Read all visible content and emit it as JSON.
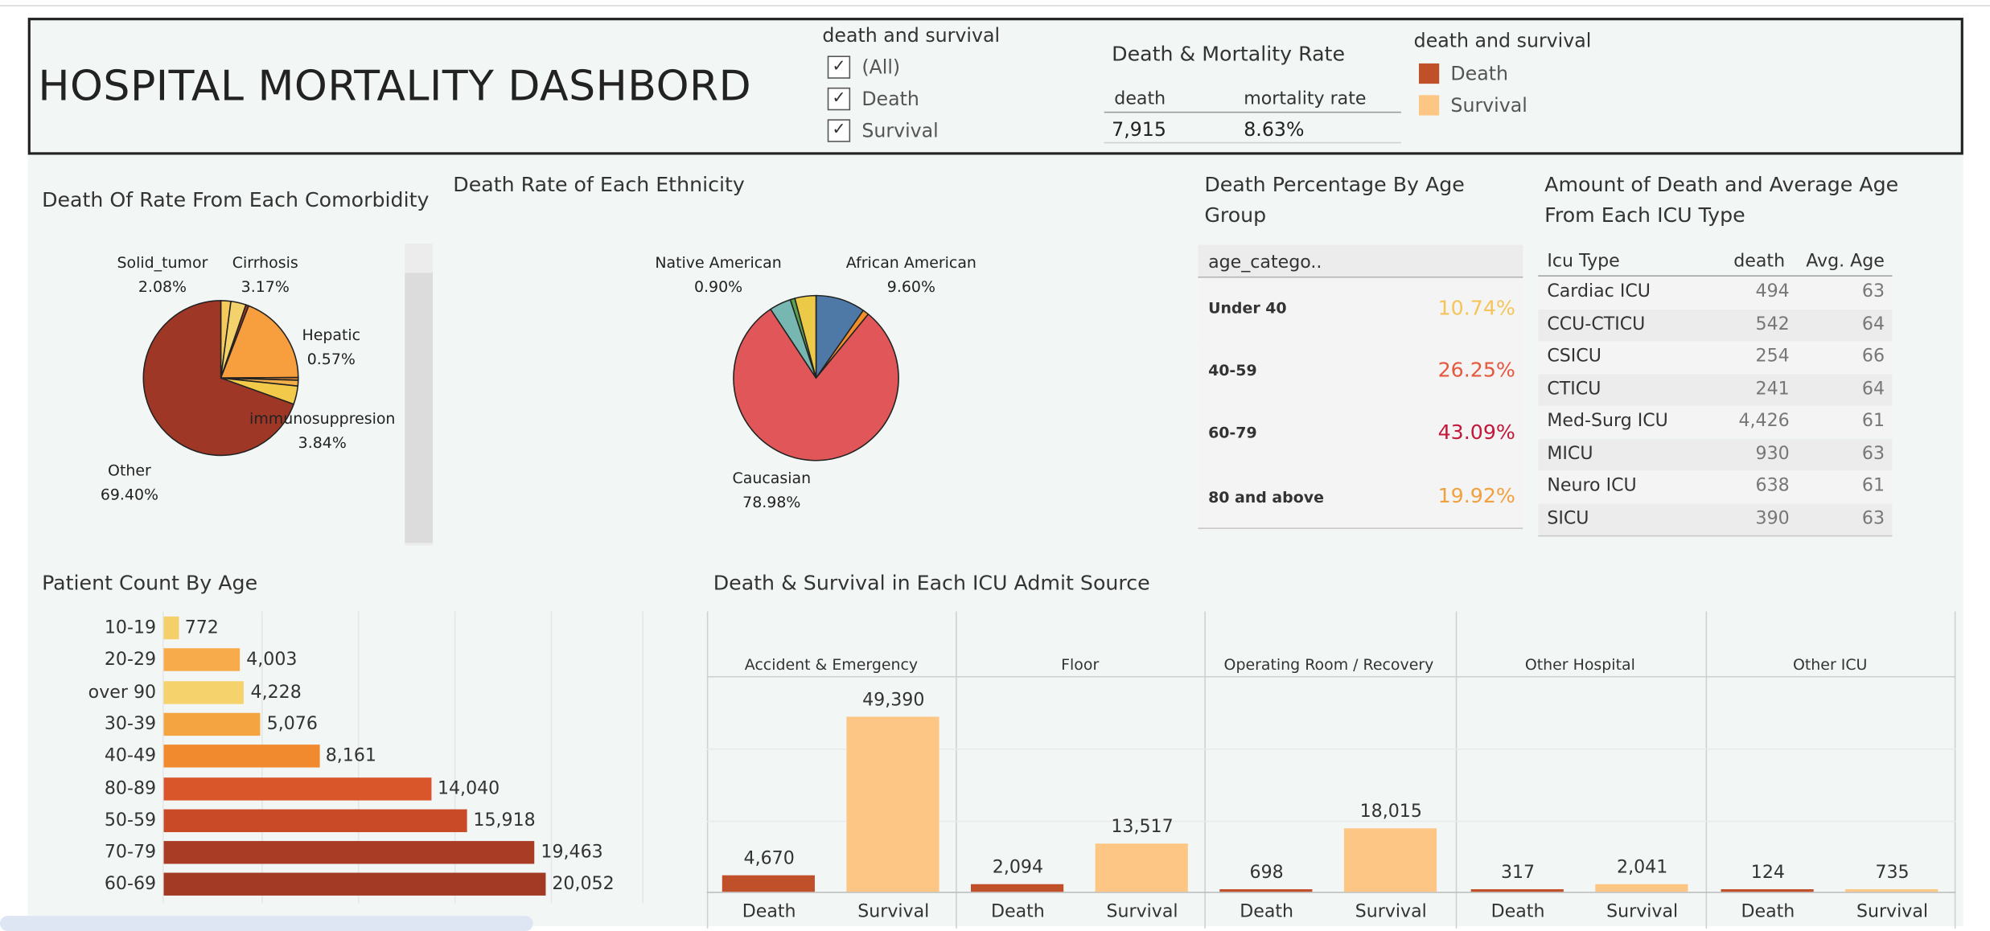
{
  "dashboard": {
    "title": "HOSPITAL MORTALITY DASHBORD"
  },
  "filter": {
    "title": "death and survival",
    "options": [
      {
        "label": "(All)",
        "checked": true
      },
      {
        "label": "Death",
        "checked": true
      },
      {
        "label": "Survival",
        "checked": true
      }
    ]
  },
  "kpi": {
    "title": "Death & Mortality Rate",
    "headers": [
      "death",
      "mortality rate"
    ],
    "values": [
      "7,915",
      "8.63%"
    ]
  },
  "legend": {
    "title": "death and survival",
    "items": [
      {
        "label": "Death",
        "color": "#c0502a"
      },
      {
        "label": "Survival",
        "color": "#fdc684"
      }
    ]
  },
  "comorbidity": {
    "title": "Death Of Rate From Each Comorbidity",
    "slices": [
      {
        "name": "Solid_tumor",
        "pct": "2.08%",
        "value": 2.08,
        "color": "#f5c95a"
      },
      {
        "name": "Cirrhosis",
        "pct": "3.17%",
        "value": 3.17,
        "color": "#f3d26b"
      },
      {
        "name": "",
        "pct": "",
        "value": 0.6,
        "color": "#9f3523"
      },
      {
        "name": "",
        "pct": "",
        "value": 19.0,
        "color": "#f79f3e"
      },
      {
        "name": "Hepatic",
        "pct": "0.57%",
        "value": 0.57,
        "color": "#e08830"
      },
      {
        "name": "",
        "pct": "",
        "value": 1.2,
        "color": "#f5b04a"
      },
      {
        "name": "immunosuppresion",
        "pct": "3.84%",
        "value": 3.84,
        "color": "#f3c94a"
      },
      {
        "name": "Other",
        "pct": "69.40%",
        "value": 69.4,
        "color": "#9f3726"
      }
    ]
  },
  "ethnicity": {
    "title": "Death Rate of Each Ethnicity",
    "slices": [
      {
        "name": "African American",
        "pct": "9.60%",
        "value": 9.6,
        "color": "#4e79a7"
      },
      {
        "name": "",
        "pct": "",
        "value": 1.2,
        "color": "#f28e2b"
      },
      {
        "name": "Caucasian",
        "pct": "78.98%",
        "value": 78.98,
        "color": "#e15759"
      },
      {
        "name": "",
        "pct": "",
        "value": 4.2,
        "color": "#76b7b2"
      },
      {
        "name": "Native American",
        "pct": "0.90%",
        "value": 0.9,
        "color": "#59a14f"
      },
      {
        "name": "",
        "pct": "",
        "value": 4.1,
        "color": "#edc948"
      }
    ]
  },
  "age_group": {
    "title": "Death Percentage  By Age Group",
    "header": "age_catego..",
    "rows": [
      {
        "name": "Under 40",
        "pct": "10.74%",
        "color": "#f5c45a"
      },
      {
        "name": "40-59",
        "pct": "26.25%",
        "color": "#e5573f"
      },
      {
        "name": "60-79",
        "pct": "43.09%",
        "color": "#c4183a"
      },
      {
        "name": "80 and above",
        "pct": "19.92%",
        "color": "#f1a040"
      }
    ]
  },
  "icu_type": {
    "title": "Amount of Death and Average Age From Each ICU Type",
    "headers": [
      "Icu Type",
      "death",
      "Avg. Age"
    ],
    "rows": [
      {
        "type": "Cardiac ICU",
        "death": "494",
        "age": "63"
      },
      {
        "type": "CCU-CTICU",
        "death": "542",
        "age": "64"
      },
      {
        "type": "CSICU",
        "death": "254",
        "age": "66"
      },
      {
        "type": "CTICU",
        "death": "241",
        "age": "64"
      },
      {
        "type": "Med-Surg ICU",
        "death": "4,426",
        "age": "61"
      },
      {
        "type": "MICU",
        "death": "930",
        "age": "63"
      },
      {
        "type": "Neuro ICU",
        "death": "638",
        "age": "61"
      },
      {
        "type": "SICU",
        "death": "390",
        "age": "63"
      }
    ]
  },
  "patient_count": {
    "title": "Patient Count By Age",
    "rows": [
      {
        "label": "10-19",
        "value": 772,
        "display": "772",
        "color": "#f5cf6a"
      },
      {
        "label": "20-29",
        "value": 4003,
        "display": "4,003",
        "color": "#f7ab4a"
      },
      {
        "label": "over 90",
        "value": 4228,
        "display": "4,228",
        "color": "#f5d26c"
      },
      {
        "label": "30-39",
        "value": 5076,
        "display": "5,076",
        "color": "#f5a442"
      },
      {
        "label": "40-49",
        "value": 8161,
        "display": "8,161",
        "color": "#f18a2e"
      },
      {
        "label": "80-89",
        "value": 14040,
        "display": "14,040",
        "color": "#d8562a"
      },
      {
        "label": "50-59",
        "value": 15918,
        "display": "15,918",
        "color": "#c94a26"
      },
      {
        "label": "70-79",
        "value": 19463,
        "display": "19,463",
        "color": "#a83c24"
      },
      {
        "label": "60-69",
        "value": 20052,
        "display": "20,052",
        "color": "#a33a25"
      }
    ]
  },
  "chart_data": {
    "type": "bar",
    "title": "Death & Survival in Each ICU Admit Source",
    "categories": [
      "Accident & Emergency",
      "Floor",
      "Operating Room / Recovery",
      "Other Hospital",
      "Other ICU"
    ],
    "axis_labels": [
      "Death",
      "Survival"
    ],
    "series": [
      {
        "name": "Death",
        "values": [
          4670,
          2094,
          698,
          317,
          124
        ],
        "display": [
          "4,670",
          "2,094",
          "698",
          "317",
          "124"
        ],
        "color": "#c0502a"
      },
      {
        "name": "Survival",
        "values": [
          49390,
          13517,
          18015,
          2041,
          735
        ],
        "display": [
          "49,390",
          "13,517",
          "18,015",
          "2,041",
          "735"
        ],
        "color": "#fdc684"
      }
    ],
    "ylim": [
      0,
      50000
    ]
  }
}
